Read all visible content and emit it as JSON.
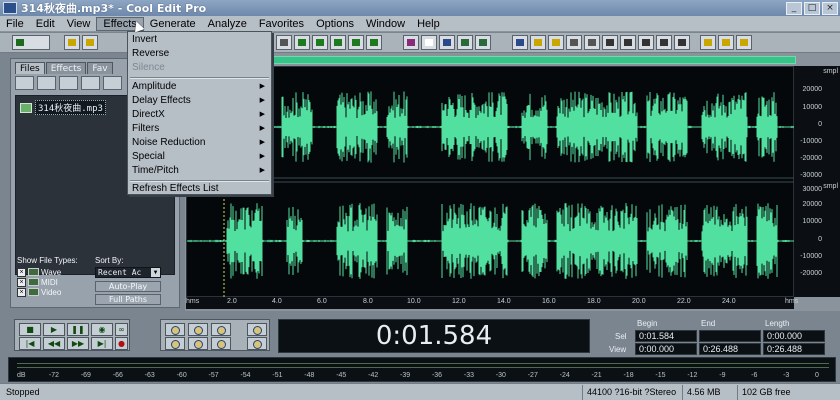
{
  "window": {
    "title": "314秋夜曲.mp3* - Cool Edit Pro"
  },
  "menubar": [
    "File",
    "Edit",
    "View",
    "Effects",
    "Generate",
    "Analyze",
    "Favorites",
    "Options",
    "Window",
    "Help"
  ],
  "effects_menu": {
    "items": [
      {
        "label": "Invert",
        "submenu": false,
        "enabled": true
      },
      {
        "label": "Reverse",
        "submenu": false,
        "enabled": true
      },
      {
        "label": "Silence",
        "submenu": false,
        "enabled": false
      },
      {
        "label": "Amplitude",
        "submenu": true,
        "enabled": true
      },
      {
        "label": "Delay Effects",
        "submenu": true,
        "enabled": true
      },
      {
        "label": "DirectX",
        "submenu": true,
        "enabled": true
      },
      {
        "label": "Filters",
        "submenu": true,
        "enabled": true
      },
      {
        "label": "Noise Reduction",
        "submenu": true,
        "enabled": true
      },
      {
        "label": "Special",
        "submenu": true,
        "enabled": true
      },
      {
        "label": "Time/Pitch",
        "submenu": true,
        "enabled": true
      },
      {
        "label": "Refresh Effects List",
        "submenu": false,
        "enabled": true
      }
    ]
  },
  "left_panel": {
    "tabs": [
      "Files",
      "Effects",
      "Fav"
    ],
    "file_name": "314秋夜曲.mp3",
    "show_file_types_label": "Show File Types:",
    "file_types": [
      "Wave",
      "MIDI",
      "Video"
    ],
    "sort_by_label": "Sort By:",
    "sort_value": "Recent Ac",
    "auto_play": "Auto-Play",
    "full_paths": "Full Paths"
  },
  "vertical_scale": {
    "unit": "smpl",
    "top_channel": [
      "20000",
      "10000",
      "0",
      "-10000",
      "-20000"
    ],
    "bottom_channel_top": "-30000",
    "bottom_channel": [
      "30000",
      "20000",
      "10000",
      "0",
      "-10000",
      "-20000"
    ]
  },
  "horizontal_scale": {
    "unit": "hms",
    "ticks": [
      "2.0",
      "4.0",
      "6.0",
      "8.0",
      "10.0",
      "12.0",
      "14.0",
      "16.0",
      "18.0",
      "20.0",
      "22.0",
      "24.0"
    ]
  },
  "transport": {
    "time": "0:01.584"
  },
  "selection": {
    "cols": [
      "Begin",
      "End",
      "Length"
    ],
    "rows": [
      {
        "label": "Sel",
        "begin": "0:01.584",
        "end": "",
        "length": "0:00.000"
      },
      {
        "label": "View",
        "begin": "0:00.000",
        "end": "0:26.488",
        "length": "0:26.488"
      }
    ]
  },
  "meter": {
    "ticks": [
      "dB",
      "-72",
      "-69",
      "-66",
      "-63",
      "-60",
      "-57",
      "-54",
      "-51",
      "-48",
      "-45",
      "-42",
      "-39",
      "-36",
      "-33",
      "-30",
      "-27",
      "-24",
      "-21",
      "-18",
      "-15",
      "-12",
      "-9",
      "-6",
      "-3",
      "0"
    ]
  },
  "status": {
    "state": "Stopped",
    "format": "44100 ?16-bit ?Stereo",
    "size": "4.56 MB",
    "free": "102 GB free"
  },
  "colors": {
    "waveform": "#52e0a0",
    "background": "#05080a",
    "range": "#38c38a"
  }
}
